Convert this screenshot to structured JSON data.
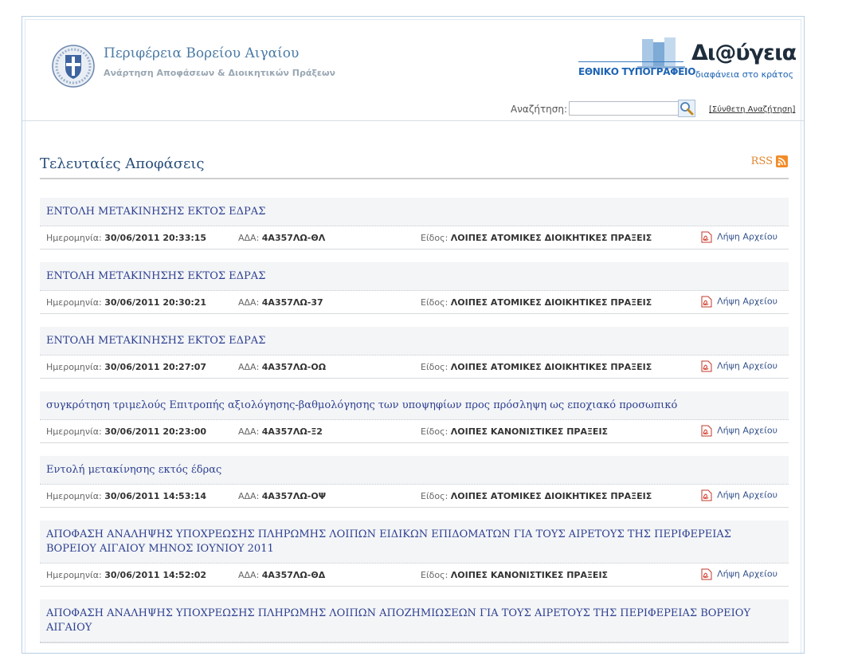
{
  "header": {
    "title": "Περιφέρεια Βορείου Αιγαίου",
    "subtitle": "Ανάρτηση Αποφάσεων & Διοικητικών Πράξεων",
    "logo_left": "ΕΘΝΙΚΟ ΤΥΠΟΓΡΑΦΕΙΟ",
    "logo_right": "Δι@ύγεια",
    "logo_tagline": "διαφάνεια στο κράτος"
  },
  "search": {
    "label": "Αναζήτηση:",
    "value": "",
    "placeholder": "",
    "advanced_label": "[Σύνθετη Αναζήτηση]",
    "button_icon": "search-icon"
  },
  "section": {
    "title": "Τελευταίες Αποφάσεις",
    "rss_label": "RSS",
    "rss_icon": "rss-icon"
  },
  "labels": {
    "date": "Ημερομηνία:",
    "ada": "ΑΔΑ:",
    "type": "Είδος:",
    "download": "Λήψη Αρχείου"
  },
  "items": [
    {
      "title": "ΕΝΤΟΛΗ ΜΕΤΑΚΙΝΗΣΗΣ ΕΚΤΟΣ ΕΔΡΑΣ",
      "date": "30/06/2011 20:33:15",
      "ada": "4Α357ΛΩ-ΘΛ",
      "type": "ΛΟΙΠΕΣ ΑΤΟΜΙΚΕΣ ΔΙΟΙΚΗΤΙΚΕΣ ΠΡΑΞΕΙΣ"
    },
    {
      "title": "ΕΝΤΟΛΗ ΜΕΤΑΚΙΝΗΣΗΣ ΕΚΤΟΣ ΕΔΡΑΣ",
      "date": "30/06/2011 20:30:21",
      "ada": "4Α357ΛΩ-37",
      "type": "ΛΟΙΠΕΣ ΑΤΟΜΙΚΕΣ ΔΙΟΙΚΗΤΙΚΕΣ ΠΡΑΞΕΙΣ"
    },
    {
      "title": "ΕΝΤΟΛΗ ΜΕΤΑΚΙΝΗΣΗΣ ΕΚΤΟΣ ΕΔΡΑΣ",
      "date": "30/06/2011 20:27:07",
      "ada": "4Α357ΛΩ-ΟΩ",
      "type": "ΛΟΙΠΕΣ ΑΤΟΜΙΚΕΣ ΔΙΟΙΚΗΤΙΚΕΣ ΠΡΑΞΕΙΣ"
    },
    {
      "title": "συγκρότηση τριμελούς Επιτροπής αξιολόγησης-βαθμολόγησης των υποψηφίων προς πρόσληψη ως εποχιακό προσωπικό",
      "date": "30/06/2011 20:23:00",
      "ada": "4Α357ΛΩ-Ξ2",
      "type": "ΛΟΙΠΕΣ ΚΑΝΟΝΙΣΤΙΚΕΣ ΠΡΑΞΕΙΣ"
    },
    {
      "title": "Εντολή μετακίνησης εκτός έδρας",
      "date": "30/06/2011 14:53:14",
      "ada": "4Α357ΛΩ-ΟΨ",
      "type": "ΛΟΙΠΕΣ ΑΤΟΜΙΚΕΣ ΔΙΟΙΚΗΤΙΚΕΣ ΠΡΑΞΕΙΣ"
    },
    {
      "title": "ΑΠΟΦΑΣΗ ΑΝΑΛΗΨΗΣ ΥΠΟΧΡΕΩΣΗΣ ΠΛΗΡΩΜΗΣ ΛΟΙΠΩΝ ΕΙΔΙΚΩΝ ΕΠΙΔΟΜΑΤΩΝ ΓΙΑ ΤΟΥΣ ΑΙΡΕΤΟΥΣ ΤΗΣ ΠΕΡΙΦΕΡΕΙΑΣ ΒΟΡΕΙΟΥ ΑΙΓΑΙΟΥ ΜΗΝΟΣ ΙΟΥΝΙΟΥ 2011",
      "date": "30/06/2011 14:52:02",
      "ada": "4Α357ΛΩ-ΘΔ",
      "type": "ΛΟΙΠΕΣ ΚΑΝΟΝΙΣΤΙΚΕΣ ΠΡΑΞΕΙΣ"
    },
    {
      "title": "ΑΠΟΦΑΣΗ ΑΝΑΛΗΨΗΣ ΥΠΟΧΡΕΩΣΗΣ ΠΛΗΡΩΜΗΣ ΛΟΙΠΩΝ ΑΠΟΖΗΜΙΩΣΕΩΝ ΓΙΑ ΤΟΥΣ ΑΙΡΕΤΟΥΣ ΤΗΣ ΠΕΡΙΦΕΡΕΙΑΣ ΒΟΡΕΙΟΥ ΑΙΓΑΙΟΥ",
      "date": "",
      "ada": "",
      "type": ""
    }
  ],
  "colors": {
    "title_blue": "#4b7aa5",
    "link_blue": "#2e3f8f",
    "rss_orange": "#f28c28",
    "row_bg": "#f3f5f7"
  }
}
